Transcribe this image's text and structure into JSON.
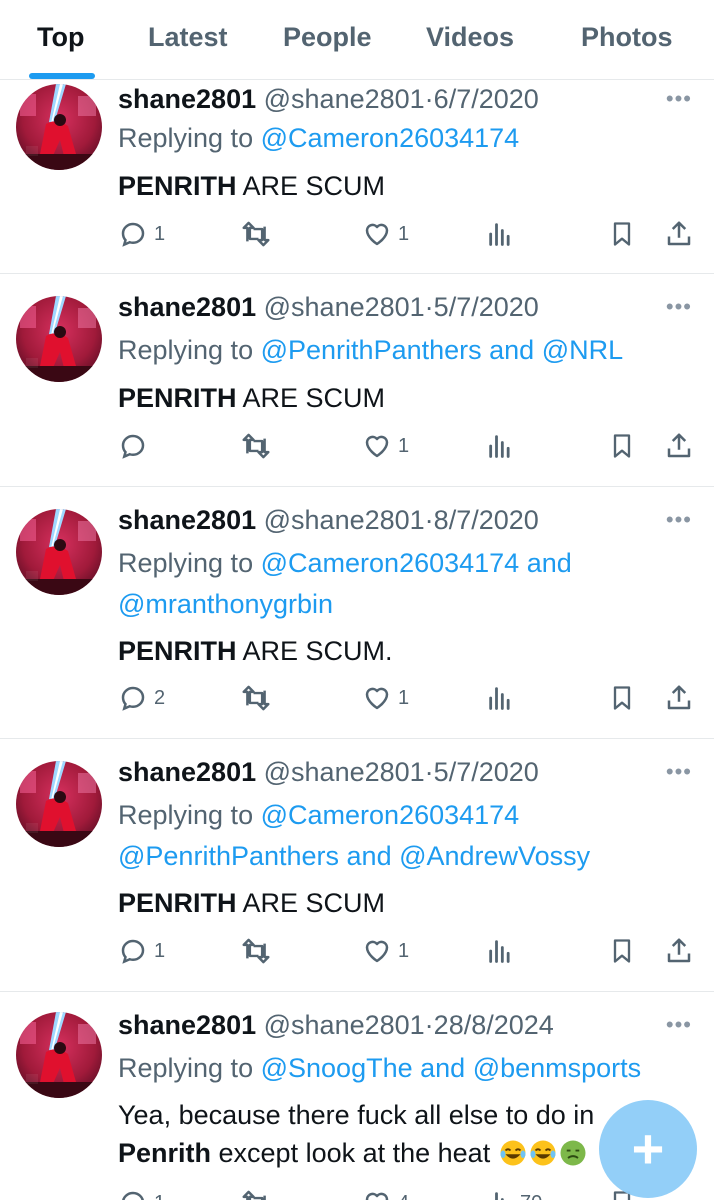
{
  "tabs": [
    {
      "label": "Top",
      "active": true
    },
    {
      "label": "Latest",
      "active": false
    },
    {
      "label": "People",
      "active": false
    },
    {
      "label": "Videos",
      "active": false
    },
    {
      "label": "Photos",
      "active": false
    }
  ],
  "tweets": [
    {
      "username": "shane2801",
      "handle": "@shane2801",
      "dot": "·",
      "date": "6/7/2020",
      "replying_prefix": "Replying to",
      "replying_lines": [
        [
          "@Cameron26034174"
        ]
      ],
      "text_bold": "PENRITH",
      "text_rest": " ARE SCUM",
      "reply_count": "1",
      "retweet_count": "",
      "like_count": "1",
      "view_count": ""
    },
    {
      "username": "shane2801",
      "handle": "@shane2801",
      "dot": "·",
      "date": "5/7/2020",
      "replying_prefix": "Replying to",
      "replying_lines": [
        [
          "@PenrithPanthers",
          " and ",
          "@NRL"
        ]
      ],
      "text_bold": "PENRITH",
      "text_rest": " ARE SCUM",
      "reply_count": "",
      "retweet_count": "",
      "like_count": "1",
      "view_count": ""
    },
    {
      "username": "shane2801",
      "handle": "@shane2801",
      "dot": "·",
      "date": "8/7/2020",
      "replying_prefix": "Replying to",
      "replying_lines": [
        [
          "@Cameron26034174",
          " and"
        ],
        [
          "@mranthonygrbin"
        ]
      ],
      "text_bold": "PENRITH",
      "text_rest": " ARE SCUM.",
      "reply_count": "2",
      "retweet_count": "",
      "like_count": "1",
      "view_count": ""
    },
    {
      "username": "shane2801",
      "handle": "@shane2801",
      "dot": "·",
      "date": "5/7/2020",
      "replying_prefix": "Replying to",
      "replying_lines": [
        [
          "@Cameron26034174"
        ],
        [
          "@PenrithPanthers",
          " and ",
          "@AndrewVossy"
        ]
      ],
      "text_bold": "PENRITH",
      "text_rest": " ARE SCUM",
      "reply_count": "1",
      "retweet_count": "",
      "like_count": "1",
      "view_count": ""
    },
    {
      "username": "shane2801",
      "handle": "@shane2801",
      "dot": "·",
      "date": "28/8/2024",
      "replying_prefix": "Replying to",
      "replying_lines": [
        [
          "@SnoogThe",
          " and ",
          "@benmsports"
        ]
      ],
      "text_line1": "Yea, because there fuck all else to do in",
      "text_bold": "Penrith",
      "text_rest": " except look at the heat",
      "emojis": [
        "face-with-tears-of-joy",
        "face-with-tears-of-joy",
        "nauseated-face"
      ],
      "reply_count": "1",
      "retweet_count": "",
      "like_count": "4",
      "view_count": "70"
    }
  ],
  "icons": {
    "reply": "reply-icon",
    "retweet": "retweet-icon",
    "like": "heart-icon",
    "views": "views-icon",
    "bookmark": "bookmark-icon",
    "share": "share-icon",
    "more": "more-icon",
    "compose": "compose-plus-icon"
  },
  "colors": {
    "accent": "#1d9bf0",
    "text": "#0f1419",
    "muted": "#536471",
    "divider": "#e6e9eb",
    "fab": "#8ecdf8"
  }
}
